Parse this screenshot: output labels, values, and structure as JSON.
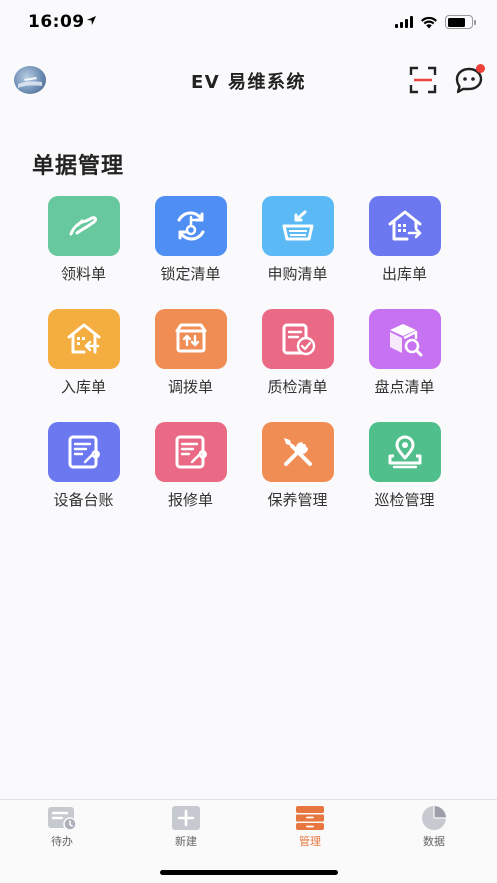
{
  "status": {
    "time": "16:09"
  },
  "header": {
    "title": "EV 易维系统",
    "icons": [
      "avatar",
      "scan-icon",
      "message-icon"
    ]
  },
  "section": {
    "title": "单据管理"
  },
  "colors": {
    "green": "#67c79d",
    "blue": "#4f8ef2",
    "sky": "#5bbaf6",
    "indigo": "#6b78f0",
    "amber": "#f4ad3f",
    "orange": "#f08d54",
    "rose": "#ea6a86",
    "violet": "#c772f0",
    "teal": "#50bf8b",
    "tab_active": "#e8773f"
  },
  "items": [
    {
      "label": "领料单",
      "icon": "pick-icon"
    },
    {
      "label": "锁定清单",
      "icon": "lock-refresh-icon"
    },
    {
      "label": "申购清单",
      "icon": "basket-icon"
    },
    {
      "label": "出库单",
      "icon": "warehouse-out-icon"
    },
    {
      "label": "入库单",
      "icon": "warehouse-in-icon"
    },
    {
      "label": "调拨单",
      "icon": "transfer-box-icon"
    },
    {
      "label": "质检清单",
      "icon": "inspect-doc-icon"
    },
    {
      "label": "盘点清单",
      "icon": "inventory-box-icon"
    },
    {
      "label": "设备台账",
      "icon": "equipment-ledger-icon"
    },
    {
      "label": "报修单",
      "icon": "repair-form-icon"
    },
    {
      "label": "保养管理",
      "icon": "tools-icon"
    },
    {
      "label": "巡检管理",
      "icon": "patrol-location-icon"
    }
  ],
  "tabs": [
    {
      "label": "待办",
      "icon": "todo-icon"
    },
    {
      "label": "新建",
      "icon": "add-icon"
    },
    {
      "label": "管理",
      "icon": "manage-icon",
      "active": true
    },
    {
      "label": "数据",
      "icon": "chart-icon"
    }
  ]
}
